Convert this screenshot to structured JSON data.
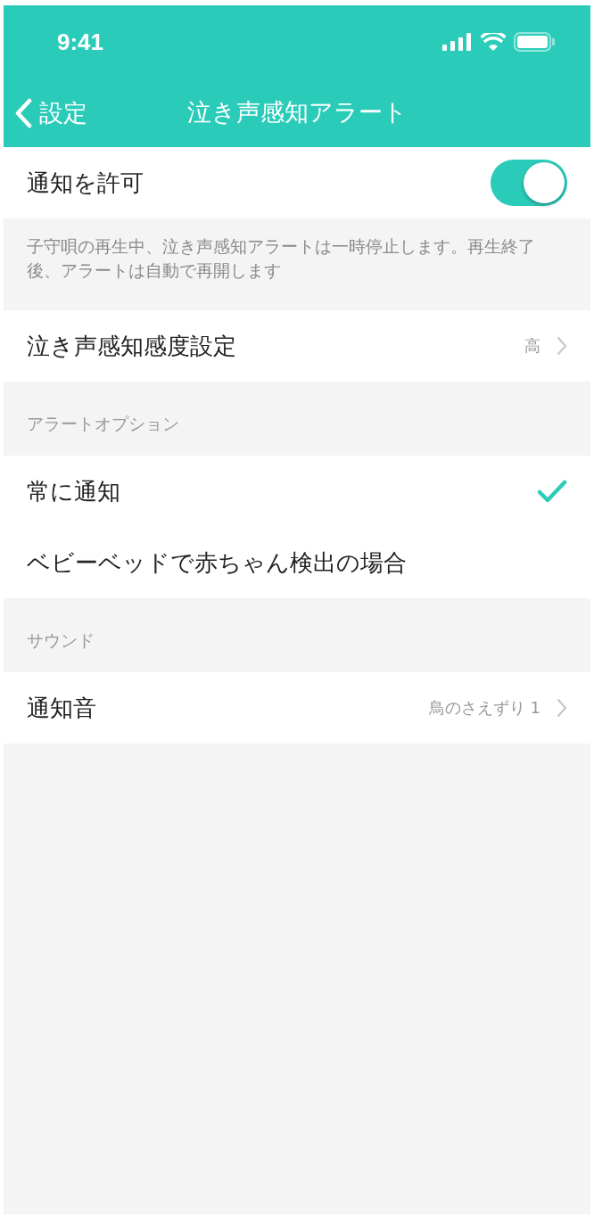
{
  "status_bar": {
    "time": "9:41"
  },
  "nav": {
    "back_label": "設定",
    "title": "泣き声感知アラート"
  },
  "rows": [
    {
      "kind": "toggle",
      "label": "通知を許可",
      "on": true
    },
    {
      "kind": "note",
      "text": "子守唄の再生中、泣き声感知アラートは一時停止します。再生終了後、アラートは自動で再開します"
    },
    {
      "kind": "link",
      "label": "泣き声感知感度設定",
      "value": "高"
    },
    {
      "kind": "header",
      "label": "アラートオプション"
    },
    {
      "kind": "option",
      "label": "常に通知",
      "selected": true
    },
    {
      "kind": "option",
      "label": "ベビーベッドで赤ちゃん検出の場合",
      "selected": false
    },
    {
      "kind": "header",
      "label": "サウンド"
    },
    {
      "kind": "link",
      "label": "通知音",
      "value": "鳥のさえずり 1"
    }
  ]
}
